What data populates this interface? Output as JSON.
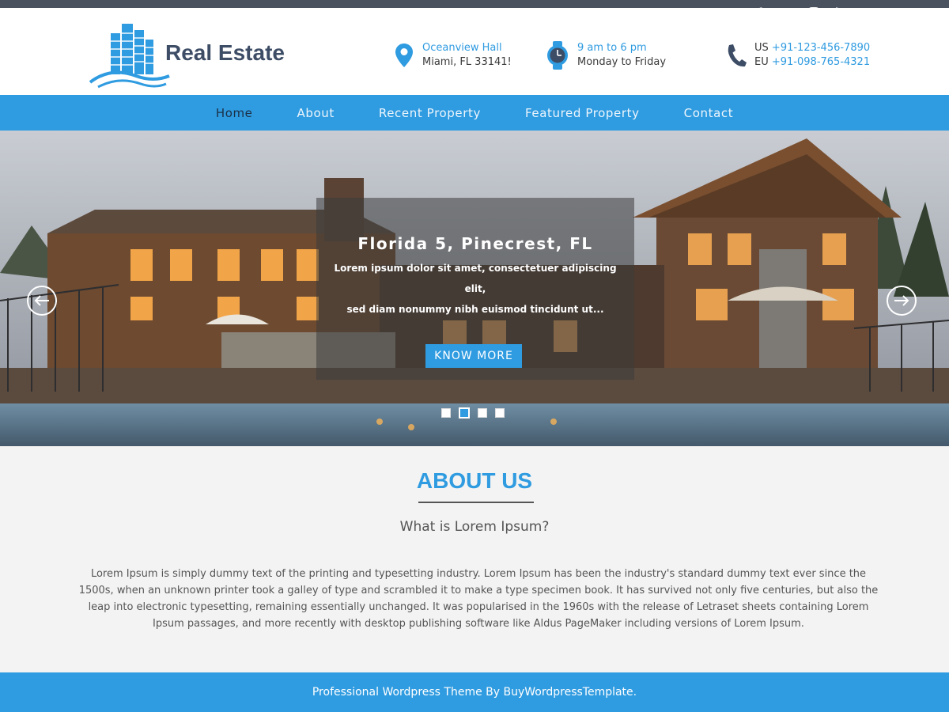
{
  "colors": {
    "accent": "#2f9be0",
    "topbar": "#4a5260",
    "brand_text": "#3d4d66"
  },
  "topbar": {
    "social": [
      {
        "icon": "facebook-icon",
        "glyph": "f"
      },
      {
        "icon": "twitter-icon",
        "glyph": "t"
      },
      {
        "icon": "instagram-icon",
        "glyph": "◎"
      },
      {
        "icon": "linkedin-icon",
        "glyph": "in"
      },
      {
        "icon": "google-plus-icon",
        "glyph": "G+"
      }
    ]
  },
  "header": {
    "brand": "Real Estate",
    "address": {
      "line1": "Oceanview Hall",
      "line2": "Miami, FL 33141!"
    },
    "hours": {
      "line1": "9 am to 6 pm",
      "line2": "Monday to Friday"
    },
    "phones": {
      "us_label": "US",
      "us": "+91-123-456-7890",
      "eu_label": "EU",
      "eu": "+91-098-765-4321"
    }
  },
  "nav": {
    "items": [
      "Home",
      "About",
      "Recent Property",
      "Featured Property",
      "Contact"
    ],
    "active": 0
  },
  "slider": {
    "title": "Florida 5, Pinecrest, FL",
    "text_line1": "Lorem ipsum dolor sit amet, consectetuer adipiscing elit,",
    "text_line2": "sed diam nonummy nibh euismod tincidunt ut...",
    "button": "KNOW MORE",
    "prev_icon": "arrow-left-icon",
    "next_icon": "arrow-right-icon",
    "slide_count": 4,
    "active_slide": 2
  },
  "about": {
    "heading": "ABOUT US",
    "subheading": "What is Lorem Ipsum?",
    "body": "Lorem Ipsum is simply dummy text of the printing and typesetting industry. Lorem Ipsum has been the industry's standard dummy text ever since the 1500s, when an unknown printer took a galley of type and scrambled it to make a type specimen book. It has survived not only five centuries, but also the leap into electronic typesetting, remaining essentially unchanged. It was popularised in the 1960s with the release of Letraset sheets containing Lorem Ipsum passages, and more recently with desktop publishing software like Aldus PageMaker including versions of Lorem Ipsum."
  },
  "footer": {
    "text": "Professional Wordpress Theme By BuyWordpressTemplate."
  }
}
